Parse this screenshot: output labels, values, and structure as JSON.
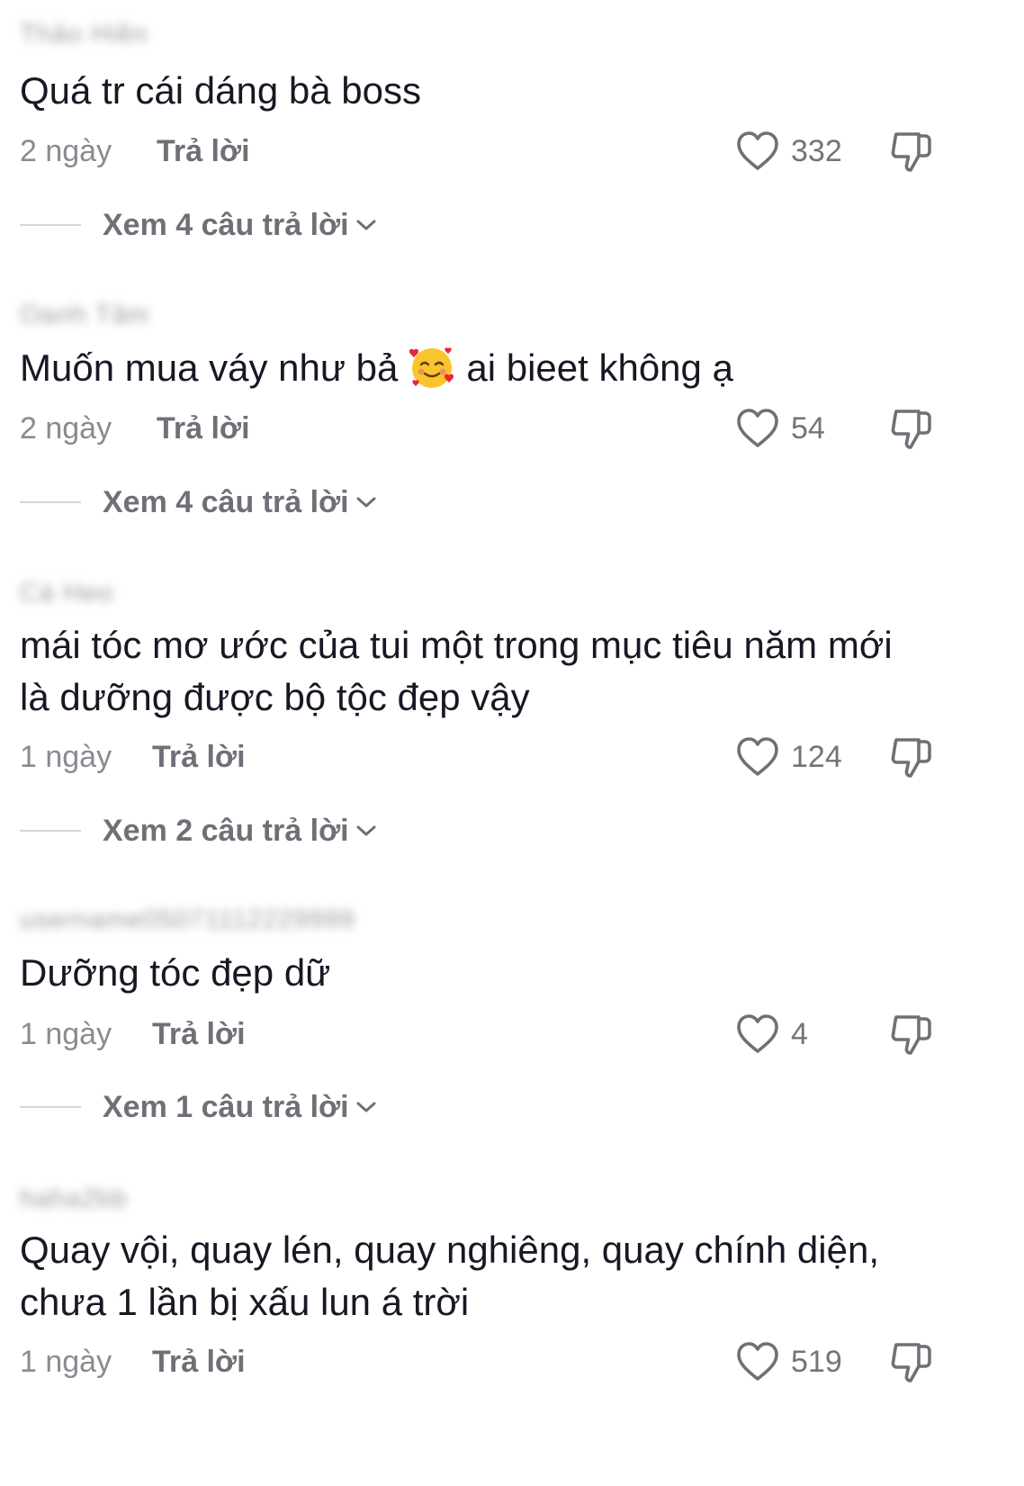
{
  "comments": [
    {
      "username": "Thảo Hiền",
      "text": "Quá tr cái dáng bà boss",
      "time": "2 ngày",
      "reply_label": "Trả lời",
      "likes": "332",
      "view_replies": "Xem 4 câu trả lời"
    },
    {
      "username": "Oanh Tâm",
      "text_before": "Muốn mua váy như bả",
      "emoji": "smiling-face-with-hearts",
      "text_after": "ai bieet không ạ",
      "time": "2 ngày",
      "reply_label": "Trả lời",
      "likes": "54",
      "view_replies": "Xem 4 câu trả lời"
    },
    {
      "username": "Cá Heo",
      "text": "mái tóc mơ ước của tui một trong mục tiêu năm mới là dưỡng được bộ tộc đẹp vậy",
      "time": "1 ngày",
      "reply_label": "Trả lời",
      "likes": "124",
      "view_replies": "Xem 2 câu trả lời"
    },
    {
      "username": "username05071112229999",
      "text": "Dưỡng tóc đẹp dữ",
      "time": "1 ngày",
      "reply_label": "Trả lời",
      "likes": "4",
      "view_replies": "Xem 1 câu trả lời"
    },
    {
      "username": "haha2bb",
      "text": "Quay vội, quay lén, quay nghiêng, quay chính diện, chưa 1 lần bị xấu lun á trời",
      "time": "1 ngày",
      "reply_label": "Trả lời",
      "likes": "519"
    }
  ],
  "colors": {
    "text": "#161823",
    "meta": "#8a8b91",
    "icon": "#6f7077",
    "divider": "#d5d6d9"
  },
  "icons": {
    "like": "heart-outline-icon",
    "dislike": "thumbs-down-icon",
    "expand": "chevron-down-icon"
  }
}
